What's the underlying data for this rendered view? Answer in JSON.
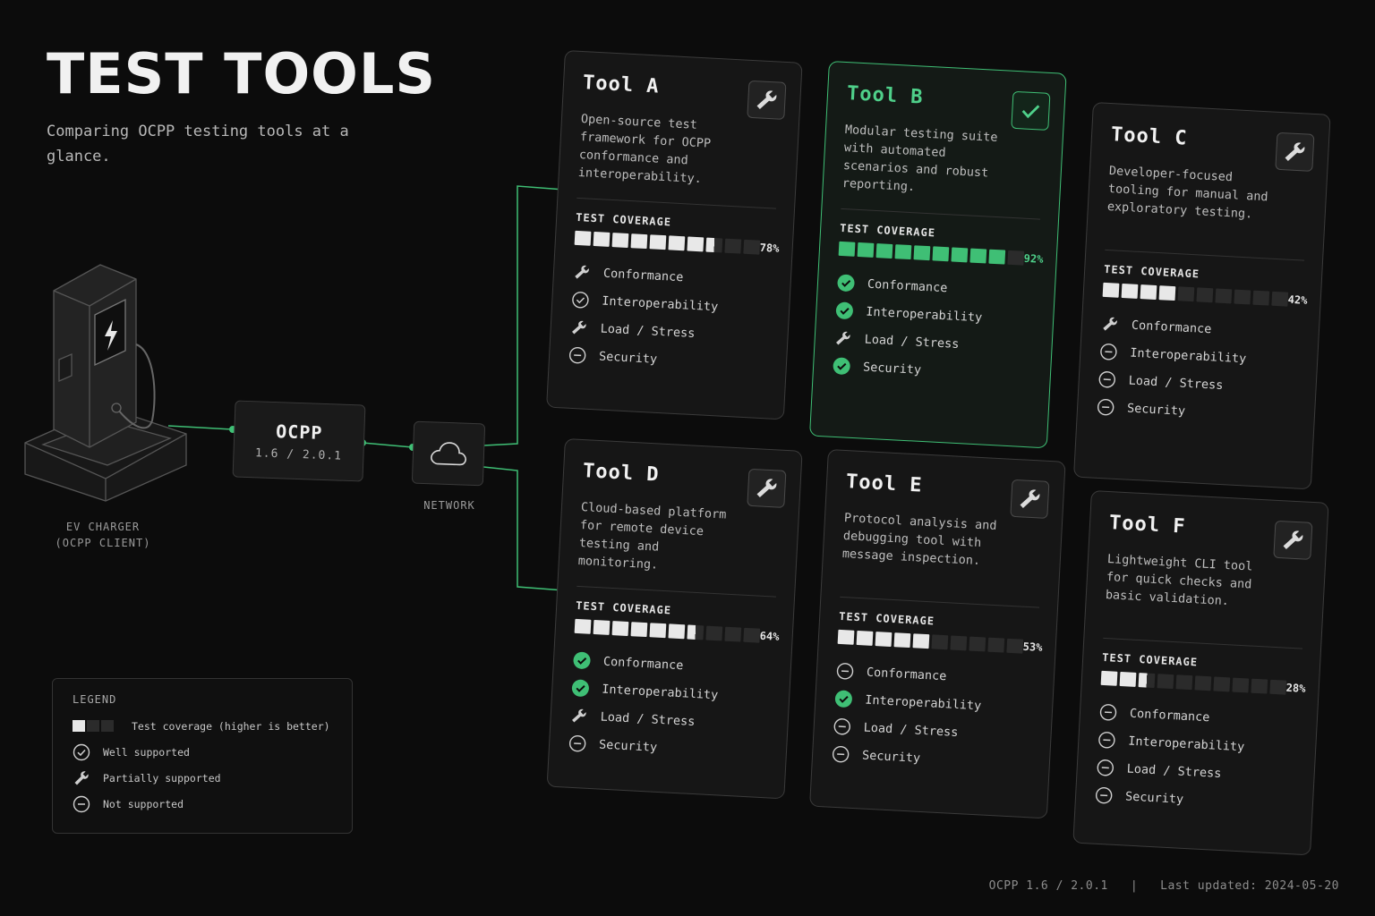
{
  "header": {
    "title": "TEST TOOLS",
    "subtitle": "Comparing OCPP testing tools at a glance."
  },
  "diagram": {
    "charger_label_line1": "EV CHARGER",
    "charger_label_line2": "(OCPP CLIENT)",
    "ocpp_title": "OCPP",
    "ocpp_versions": "1.6 / 2.0.1",
    "network_label": "NETWORK"
  },
  "colors": {
    "accent": "#3fbf75",
    "background": "#0c0c0c",
    "card": "#161616"
  },
  "coverage_label": "TEST COVERAGE",
  "feature_labels": [
    "Conformance",
    "Interoperability",
    "Load / Stress",
    "Security"
  ],
  "tools": [
    {
      "name": "Tool A",
      "description": "Open-source test framework for OCPP conformance and interoperability.",
      "coverage": 78,
      "coverage_text": "78%",
      "highlighted": false,
      "badge_icon": "wrench-icon",
      "features": [
        "partial",
        "well",
        "partial",
        "none"
      ]
    },
    {
      "name": "Tool B",
      "description": "Modular testing suite with automated scenarios and robust reporting.",
      "coverage": 92,
      "coverage_text": "92%",
      "highlighted": true,
      "badge_icon": "check-icon",
      "features": [
        "well-filled",
        "well-filled",
        "partial",
        "well-filled"
      ]
    },
    {
      "name": "Tool C",
      "description": "Developer-focused tooling for manual and exploratory testing.",
      "coverage": 42,
      "coverage_text": "42%",
      "highlighted": false,
      "badge_icon": "wrench-icon",
      "features": [
        "partial",
        "none",
        "none",
        "none"
      ]
    },
    {
      "name": "Tool D",
      "description": "Cloud-based platform for remote device testing and monitoring.",
      "coverage": 64,
      "coverage_text": "64%",
      "highlighted": false,
      "badge_icon": "wrench-icon",
      "features": [
        "well-filled",
        "well-filled",
        "partial",
        "none"
      ]
    },
    {
      "name": "Tool E",
      "description": "Protocol analysis and debugging tool with message inspection.",
      "coverage": 53,
      "coverage_text": "53%",
      "highlighted": false,
      "badge_icon": "wrench-icon",
      "features": [
        "none",
        "well-filled",
        "none",
        "none"
      ]
    },
    {
      "name": "Tool F",
      "description": "Lightweight CLI tool for quick checks and basic validation.",
      "coverage": 28,
      "coverage_text": "28%",
      "highlighted": false,
      "badge_icon": "wrench-icon",
      "features": [
        "none",
        "none",
        "none",
        "none"
      ]
    }
  ],
  "legend": {
    "title": "LEGEND",
    "items": [
      {
        "icon": "coverage-bar",
        "label": "Test coverage (higher is better)"
      },
      {
        "icon": "check-circle-icon",
        "label": "Well supported"
      },
      {
        "icon": "wrench-icon",
        "label": "Partially supported"
      },
      {
        "icon": "minus-circle-icon",
        "label": "Not supported"
      }
    ]
  },
  "footer": {
    "text": "OCPP 1.6 / 2.0.1   |   Last updated: 2024-05-20"
  }
}
